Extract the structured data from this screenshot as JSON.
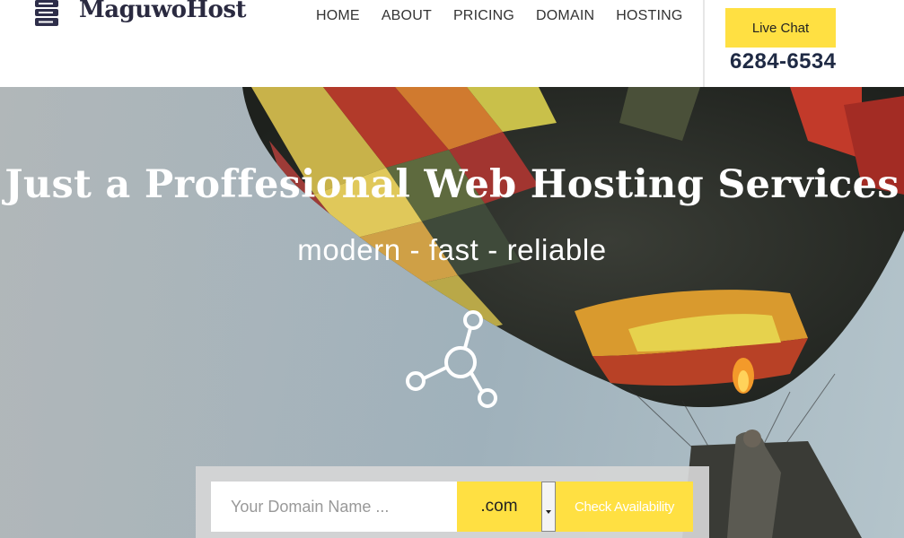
{
  "brand": {
    "name": "MaguwoHost",
    "logo_icon": "server-icon"
  },
  "nav": {
    "items": [
      {
        "label": "HOME"
      },
      {
        "label": "ABOUT"
      },
      {
        "label": "PRICING"
      },
      {
        "label": "DOMAIN"
      },
      {
        "label": "HOSTING"
      }
    ]
  },
  "support": {
    "live_chat_label": "Live Chat",
    "phone": "6284-6534"
  },
  "hero": {
    "title": "Just a Proffesional Web Hosting Services",
    "subtitle": "modern - fast - reliable",
    "icon": "share-network-icon"
  },
  "domain_search": {
    "placeholder": "Your Domain Name ...",
    "tld_selected": ".com",
    "button_label": "Check Availability"
  },
  "colors": {
    "accent": "#ffe042",
    "dark_text": "#1f2a44",
    "hero_sky": "#a7b4bb"
  }
}
